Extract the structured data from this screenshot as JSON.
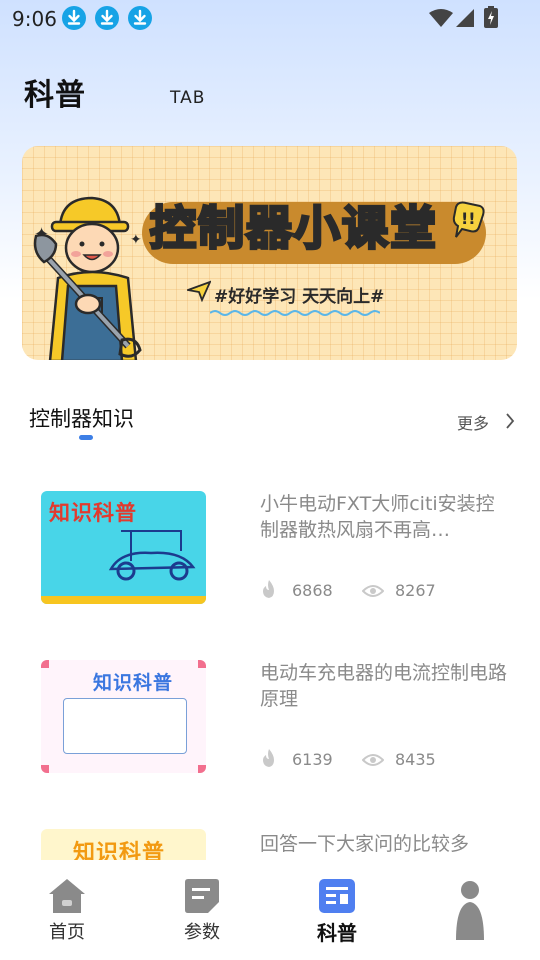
{
  "status_bar": {
    "time": "9:06",
    "notification_icons": [
      "download-icon",
      "download-icon",
      "download-icon"
    ],
    "system_icons": [
      "wifi-icon",
      "signal-icon",
      "battery-charging-icon"
    ]
  },
  "header": {
    "title": "科普",
    "tab_label": "TAB"
  },
  "banner": {
    "title": "控制器小课堂",
    "slogan": "#好好学习 天天向上#"
  },
  "section": {
    "title": "控制器知识",
    "more_label": "更多"
  },
  "articles": [
    {
      "thumb_title": "知识科普",
      "title": "小牛电动FXT大师citi安装控制器散热风扇不再高…",
      "likes": "6868",
      "views": "8267"
    },
    {
      "thumb_title": "知识科普",
      "title": "电动车充电器的电流控制电路原理",
      "likes": "6139",
      "views": "8435"
    },
    {
      "thumb_title": "知识科普",
      "title": "回答一下大家问的比较多",
      "likes": "",
      "views": ""
    }
  ],
  "bottom_nav": {
    "items": [
      {
        "label": "首页",
        "icon": "home-icon",
        "active": false
      },
      {
        "label": "参数",
        "icon": "params-icon",
        "active": false
      },
      {
        "label": "科普",
        "icon": "science-icon",
        "active": true
      },
      {
        "label": "",
        "icon": "profile-icon",
        "active": false
      }
    ]
  },
  "colors": {
    "accent": "#3d7fe6",
    "download_badge": "#17a3e6",
    "banner_bg": "#fde6b7",
    "muted_text": "#8a8a8a"
  }
}
